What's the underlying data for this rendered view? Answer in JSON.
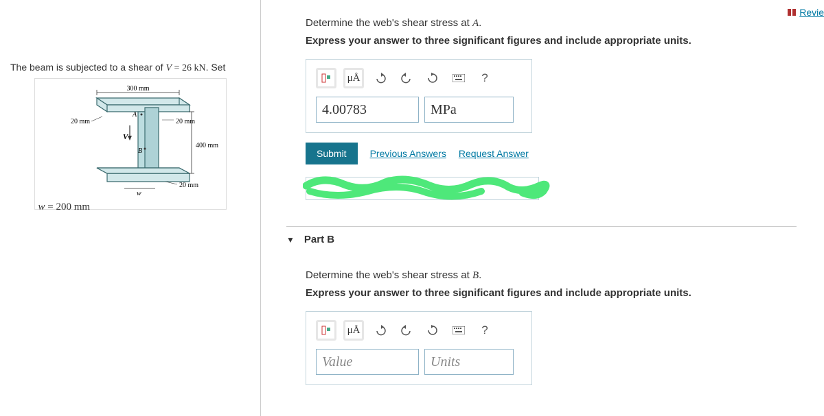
{
  "header": {
    "review_link": "Revie"
  },
  "problem": {
    "intro_prefix": "The beam is subjected to a shear of ",
    "var_v": "V",
    "equals": " = ",
    "v_value": "26 kN",
    "intro_suffix": ". Set",
    "figure": {
      "top_dim": "300 mm",
      "left_flange": "20 mm",
      "right_web": "20 mm",
      "depth": "400 mm",
      "bottom_flange": "20 mm",
      "point_a": "A",
      "point_b": "B",
      "force_v": "V",
      "width_w": "w"
    },
    "w_label_prefix": "w",
    "w_label_eq": " = ",
    "w_label_val": "200 mm"
  },
  "partA": {
    "question_prefix": "Determine the web's shear stress at ",
    "question_var": "A",
    "question_suffix": ".",
    "instruction": "Express your answer to three significant figures and include appropriate units.",
    "toolbar": {
      "mu_a": "μÅ",
      "help": "?"
    },
    "value": "4.00783",
    "units": "MPa",
    "submit": "Submit",
    "prev_answers": "Previous Answers",
    "request_answer": "Request Answer"
  },
  "partB": {
    "header": "Part B",
    "question_prefix": "Determine the web's shear stress at ",
    "question_var": "B",
    "question_suffix": ".",
    "instruction": "Express your answer to three significant figures and include appropriate units.",
    "toolbar": {
      "mu_a": "μÅ",
      "help": "?"
    },
    "value_placeholder": "Value",
    "units_placeholder": "Units"
  }
}
